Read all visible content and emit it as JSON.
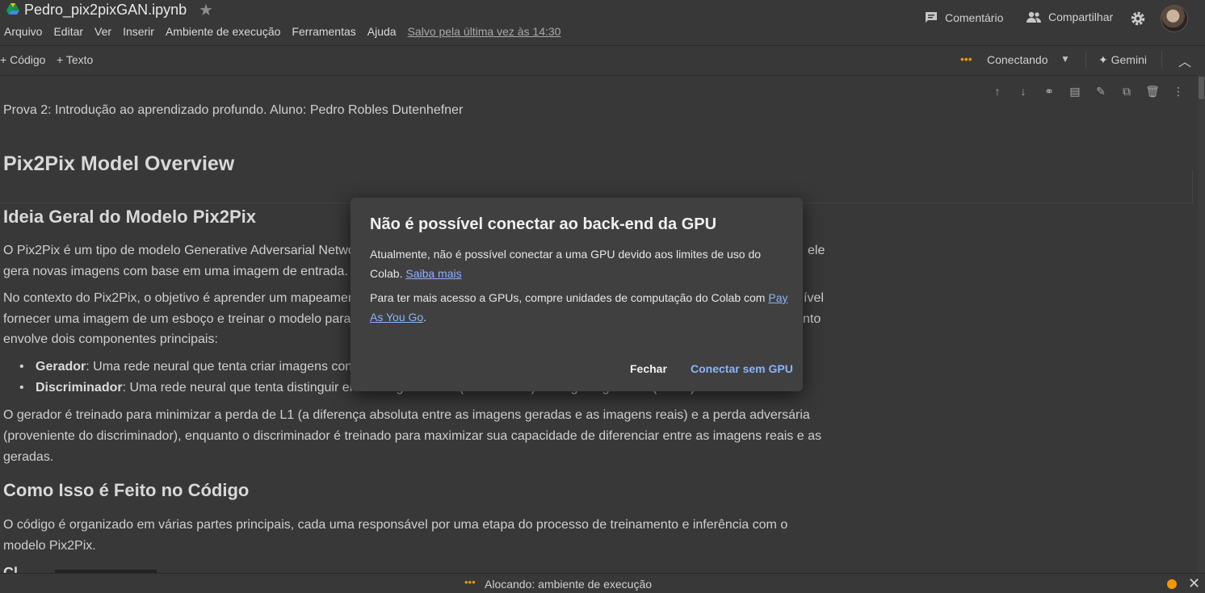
{
  "header": {
    "title": "Pedro_pix2pixGAN.ipynb",
    "menu": [
      "Arquivo",
      "Editar",
      "Ver",
      "Inserir",
      "Ambiente de execução",
      "Ferramentas",
      "Ajuda"
    ],
    "saved": "Salvo pela última vez às 14:30",
    "comment": "Comentário",
    "share": "Compartilhar"
  },
  "toolbar": {
    "add_code": "Código",
    "add_text": "Texto",
    "connection": "Conectando",
    "gemini": "Gemini"
  },
  "notebook": {
    "intro": "Prova 2: Introdução ao aprendizado profundo. Aluno: Pedro Robles Dutenhefner",
    "h1": "Pix2Pix Model Overview",
    "h2a": "Ideia Geral do Modelo Pix2Pix",
    "p1": "O Pix2Pix é um tipo de modelo Generative Adversarial Netwo",
    "p1_right": "ele",
    "p1_line2": "gera novas imagens com base em uma imagem de entrada.",
    "p2_line1": "No contexto do Pix2Pix, o objetivo é aprender um mapeamer",
    "p2_line1_right": "ível",
    "p2_line2": "fornecer uma imagem de um esboço e treinar o modelo para",
    "p2_line2_right": "nto",
    "p2_line3": "envolve dois componentes principais:",
    "bullet1_bold": "Gerador",
    "bullet1_text": ": Uma rede neural que tenta criar imagens conv",
    "bullet2_bold": "Discriminador",
    "bullet2_text": ": Uma rede neural que tenta distinguir entre imagens reais (verdadeiras) e imagens geradas (falsas).",
    "p3": "O gerador é treinado para minimizar a perda de L1 (a diferença absoluta entre as imagens geradas e as imagens reais) e a perda adversária (proveniente do discriminador), enquanto o discriminador é treinado para maximizar sua capacidade de diferenciar entre as imagens reais e as geradas.",
    "h2b": "Como Isso é Feito no Código",
    "p4": "O código é organizado em várias partes principais, cada uma responsável por uma etapa do processo de treinamento e inferência com o modelo Pix2Pix.",
    "cut_heading": "Cl"
  },
  "dialog": {
    "title": "Não é possível conectar ao back-end da GPU",
    "p1_text": "Atualmente, não é possível conectar a uma GPU devido aos limites de uso do Colab. ",
    "p1_link": "Saiba mais",
    "p2_text": "Para ter mais acesso a GPUs, compre unidades de computação do Colab com ",
    "p2_link": "Pay As You Go",
    "p2_end": ".",
    "close": "Fechar",
    "connect_no_gpu": "Conectar sem GPU"
  },
  "status": {
    "label": "Alocando: ambiente de execução"
  },
  "colors": {
    "accent": "#f29900",
    "link": "#8ab4f8",
    "background": "#383838"
  }
}
